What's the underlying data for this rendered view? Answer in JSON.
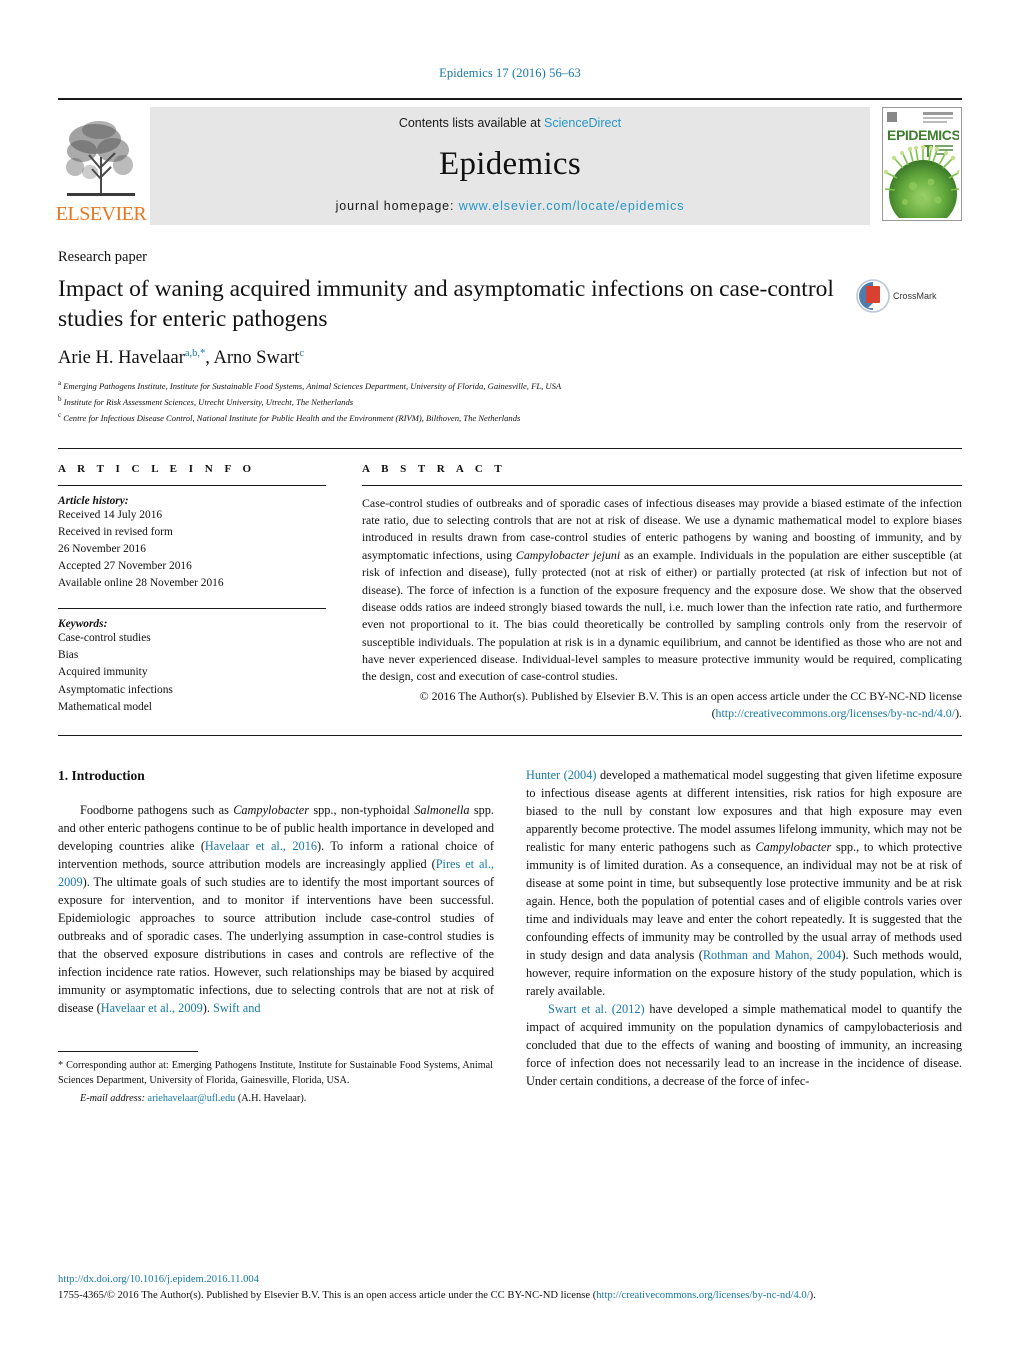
{
  "running_head": "Epidemics 17 (2016) 56–63",
  "masthead": {
    "publisher_name": "ELSEVIER",
    "contents_prefix": "Contents lists available at ",
    "contents_link": "ScienceDirect",
    "journal_name": "Epidemics",
    "homepage_prefix": "journal homepage: ",
    "homepage_url": "www.elsevier.com/locate/epidemics",
    "cover_title": "EPIDEMICS"
  },
  "article": {
    "type": "Research paper",
    "title": "Impact of waning acquired immunity and asymptomatic infections on case-control studies for enteric pathogens",
    "crossmark_label": "CrossMark",
    "authors_plain": "Arie H. Havelaar",
    "author1_sups": "a,b,*",
    "author2_plain": ", Arno Swart",
    "author2_sups": "c",
    "affiliations": [
      {
        "marker": "a",
        "text": "Emerging Pathogens Institute, Institute for Sustainable Food Systems, Animal Sciences Department, University of Florida, Gainesville, FL, USA"
      },
      {
        "marker": "b",
        "text": "Institute for Risk Assessment Sciences, Utrecht University, Utrecht, The Netherlands"
      },
      {
        "marker": "c",
        "text": "Centre for Infectious Disease Control, National Institute for Public Health and the Environment (RIVM), Bilthoven, The Netherlands"
      }
    ]
  },
  "article_info": {
    "heading": "A R T I C L E    I N F O",
    "history_label": "Article history:",
    "history": [
      "Received 14 July 2016",
      "Received in revised form",
      "26 November 2016",
      "Accepted 27 November 2016",
      "Available online 28 November 2016"
    ],
    "keywords_label": "Keywords:",
    "keywords": [
      "Case-control studies",
      "Bias",
      "Acquired immunity",
      "Asymptomatic infections",
      "Mathematical model"
    ]
  },
  "abstract": {
    "heading": "A B S T R A C T",
    "part1": "Case-control studies of outbreaks and of sporadic cases of infectious diseases may provide a biased estimate of the infection rate ratio, due to selecting controls that are not at risk of disease. We use a dynamic mathematical model to explore biases introduced in results drawn from case-control studies of enteric pathogens by waning and boosting of immunity, and by asymptomatic infections, using ",
    "italic1": "Campylobacter jejuni",
    "part2": " as an example. Individuals in the population are either susceptible (at risk of infection and disease), fully protected (not at risk of either) or partially protected (at risk of infection but not of disease). The force of infection is a function of the exposure frequency and the exposure dose. We show that the observed disease odds ratios are indeed strongly biased towards the null, i.e. much lower than the infection rate ratio, and furthermore even not proportional to it. The bias could theoretically be controlled by sampling controls only from the reservoir of susceptible individuals. The population at risk is in a dynamic equilibrium, and cannot be identified as those who are not and have never experienced disease. Individual-level samples to measure protective immunity would be required, complicating the design, cost and execution of case-control studies.",
    "copyright_pre": "© 2016 The Author(s). Published by Elsevier B.V. This is an open access article under the CC BY-NC-ND license (",
    "copyright_link": "http://creativecommons.org/licenses/by-nc-nd/4.0/",
    "copyright_post": ")."
  },
  "introduction": {
    "heading": "1.  Introduction",
    "left_p1_a": "Foodborne pathogens such as ",
    "left_p1_i1": "Campylobacter",
    "left_p1_b": " spp., non-typhoidal ",
    "left_p1_i2": "Salmonella",
    "left_p1_c": " spp. and other enteric pathogens continue to be of public health importance in developed and developing countries alike (",
    "left_link1": "Havelaar et al., 2016",
    "left_p1_d": "). To inform a rational choice of intervention methods, source attribution models are increasingly applied (",
    "left_link2": "Pires et al., 2009",
    "left_p1_e": "). The ultimate goals of such studies are to identify the most important sources of exposure for intervention, and to monitor if interventions have been successful. Epidemiologic approaches to source attribution include case-control studies of outbreaks and of sporadic cases. The underlying assumption in case-control studies is that the observed exposure distributions in cases and controls are reflective of the infection incidence rate ratios. However, such relationships may be biased by acquired immunity or asymptomatic infections, due to selecting controls that are not at risk of disease (",
    "left_link3": "Havelaar et al., 2009",
    "left_p1_f": "). ",
    "left_link4": "Swift and",
    "right_link1": "Hunter (2004)",
    "right_p1_a": " developed a mathematical model suggesting that given lifetime exposure to infectious disease agents at different intensities, risk ratios for high exposure are biased to the null by constant low exposures and that high exposure may even apparently become protective. The model assumes lifelong immunity, which may not be realistic for many enteric pathogens such as ",
    "right_i1": "Campylobacter",
    "right_p1_b": " spp., to which protective immunity is of limited duration. As a consequence, an individual may not be at risk of disease at some point in time, but subsequently lose protective immunity and be at risk again. Hence, both the population of potential cases and of eligible controls varies over time and individuals may leave and enter the cohort repeatedly. It is suggested that the confounding effects of immunity may be controlled by the usual array of methods used in study design and data analysis (",
    "right_link2": "Rothman and Mahon, 2004",
    "right_p1_c": "). Such methods would, however, require information on the exposure history of the study population, which is rarely available.",
    "right_link3": "Swart et al. (2012)",
    "right_p2_a": " have developed a simple mathematical model to quantify the impact of acquired immunity on the population dynamics of campylobacteriosis and concluded that due to the effects of waning and boosting of immunity, an increasing force of infection does not necessarily lead to an increase in the incidence of disease. Under certain conditions, a decrease of the force of infec-"
  },
  "footnote": {
    "star_text": "*  Corresponding author at: Emerging Pathogens Institute, Institute for Sustainable Food Systems, Animal Sciences Department, University of Florida, Gainesville, Florida, USA.",
    "email_label": "E-mail address:",
    "email": "ariehavelaar@ufl.edu",
    "email_suffix": " (A.H. Havelaar)."
  },
  "page_footer": {
    "doi": "http://dx.doi.org/10.1016/j.epidem.2016.11.004",
    "issn_pre": "1755-4365/© 2016 The Author(s). Published by Elsevier B.V. This is an open access article under the CC BY-NC-ND license (",
    "issn_link": "http://creativecommons.org/licenses/by-nc-nd/4.0/",
    "issn_post": ")."
  },
  "colors": {
    "link": "#1878A8",
    "sciencedirect": "#2596c8",
    "elsevier_orange": "#E87722",
    "masthead_bg": "#e6e6e6",
    "cover_green": "#6cb33f"
  }
}
